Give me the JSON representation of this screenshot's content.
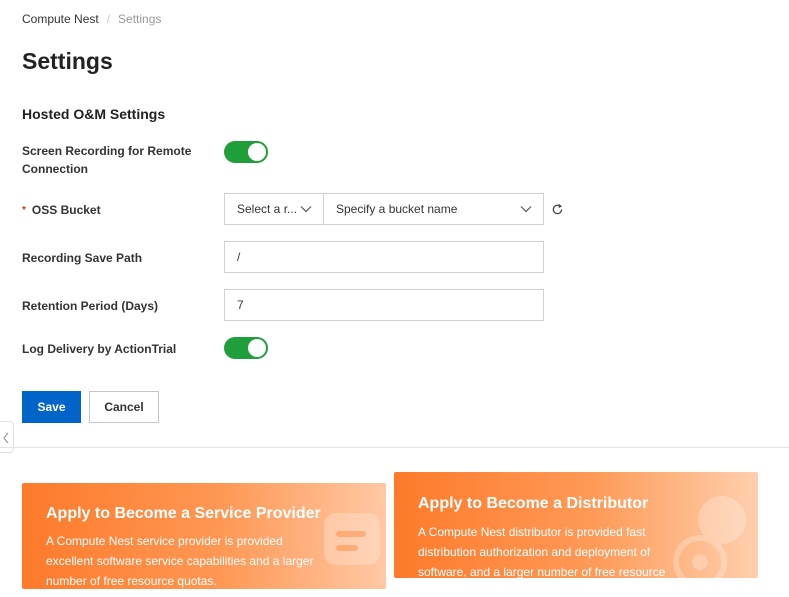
{
  "breadcrumb": {
    "items": [
      "Compute Nest",
      "Settings"
    ],
    "separator": "/"
  },
  "page": {
    "title": "Settings"
  },
  "section": {
    "title": "Hosted O&M Settings"
  },
  "form": {
    "screen_recording": {
      "label": "Screen Recording for Remote Connection",
      "enabled": true
    },
    "oss_bucket": {
      "required_mark": "*",
      "label": "OSS Bucket",
      "region_placeholder": "Select a r...",
      "bucket_placeholder": "Specify a bucket name",
      "refresh_icon": "refresh-icon"
    },
    "recording_save_path": {
      "label": "Recording Save Path",
      "value": "/"
    },
    "retention_period": {
      "label": "Retention Period (Days)",
      "value": "7"
    },
    "log_delivery": {
      "label": "Log Delivery by ActionTrial",
      "enabled": true
    }
  },
  "actions": {
    "save_label": "Save",
    "cancel_label": "Cancel"
  },
  "promos": [
    {
      "title": "Apply to Become a Service Provider",
      "description": "A Compute Nest service provider is provided excellent software service capabilities and a larger number of free resource quotas."
    },
    {
      "title": "Apply to Become a Distributor",
      "description": "A Compute Nest distributor is provided fast distribution authorization and deployment of software, and a larger number of free resource"
    }
  ],
  "colors": {
    "primary": "#0064c8",
    "toggle_on": "#1f9e3a",
    "promo_orange": "#fd7a2a",
    "required": "#d93026"
  }
}
